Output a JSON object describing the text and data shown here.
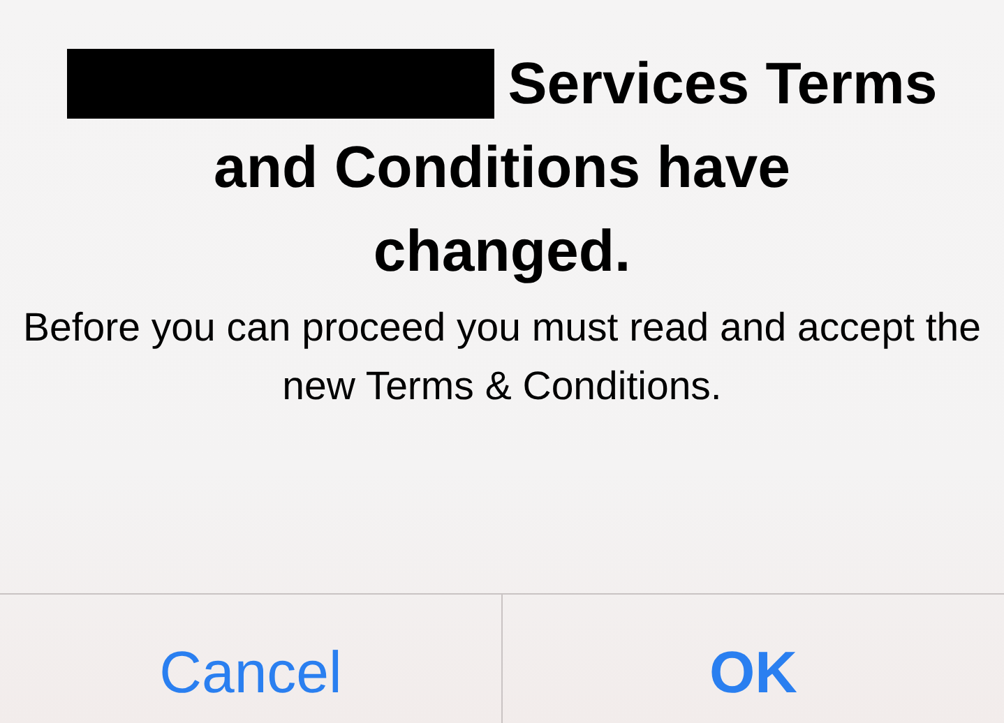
{
  "alert": {
    "title": {
      "redacted": true,
      "first_line": "Services Terms",
      "rest": "and Conditions have changed."
    },
    "message": "Before you can proceed you must read and accept the new Terms & Conditions.",
    "buttons": [
      {
        "label": "Cancel",
        "kind": "cancel"
      },
      {
        "label": "OK",
        "kind": "default"
      }
    ]
  }
}
